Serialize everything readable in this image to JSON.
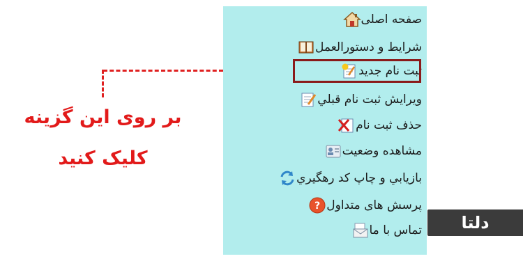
{
  "menu": {
    "items": [
      {
        "label": "صفحه اصلی",
        "icon": "home-icon"
      },
      {
        "label": "شرايط و دستورالعمل",
        "icon": "book-icon"
      },
      {
        "label": "ثبت نام جديد",
        "icon": "new-registration-icon"
      },
      {
        "label": "ويرايش ثبت نام قبلي",
        "icon": "edit-document-icon"
      },
      {
        "label": "حذف ثبت نام",
        "icon": "delete-document-icon"
      },
      {
        "label": "مشاهده وضعيت",
        "icon": "status-card-icon"
      },
      {
        "label": "بازيابي و چاپ کد رهگيري",
        "icon": "refresh-icon"
      },
      {
        "label": "پرسش های متداول",
        "icon": "help-icon"
      },
      {
        "label": "تماس با ما",
        "icon": "mail-icon"
      }
    ]
  },
  "instruction": {
    "line1": "بر روی این گزینه",
    "line2": "کلیک کنید"
  },
  "logo": {
    "text": "دلتا"
  },
  "colors": {
    "panel_bg": "#b2eded",
    "highlight": "#8a1a1a",
    "callout": "#e02020",
    "logo_bg": "#3b3b3b"
  }
}
